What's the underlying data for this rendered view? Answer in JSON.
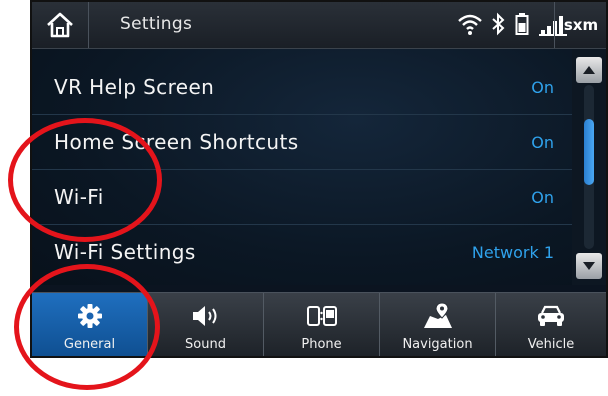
{
  "status_bar": {
    "title": "Settings",
    "home_icon": "home-icon",
    "icons": [
      "wifi-icon",
      "bluetooth-icon",
      "battery-icon",
      "signal-bars-icon"
    ],
    "sxm_label": "sxm"
  },
  "settings_list": {
    "items": [
      {
        "label": "VR Help Screen",
        "value": "On"
      },
      {
        "label": "Home Screen Shortcuts",
        "value": "On"
      },
      {
        "label": "Wi-Fi",
        "value": "On"
      },
      {
        "label": "Wi-Fi Settings",
        "value": "Network 1"
      }
    ]
  },
  "scrollbar": {
    "up_icon": "triangle-up-icon",
    "down_icon": "triangle-down-icon"
  },
  "tabs": [
    {
      "label": "General",
      "icon": "gear-icon",
      "active": true
    },
    {
      "label": "Sound",
      "icon": "speaker-icon",
      "active": false
    },
    {
      "label": "Phone",
      "icon": "phone-icon",
      "active": false
    },
    {
      "label": "Navigation",
      "icon": "map-pin-icon",
      "active": false
    },
    {
      "label": "Vehicle",
      "icon": "car-icon",
      "active": false
    }
  ],
  "colors": {
    "accent": "#2fa2ec",
    "active_tab": "#1a63b0",
    "annotation": "#e4141b"
  }
}
